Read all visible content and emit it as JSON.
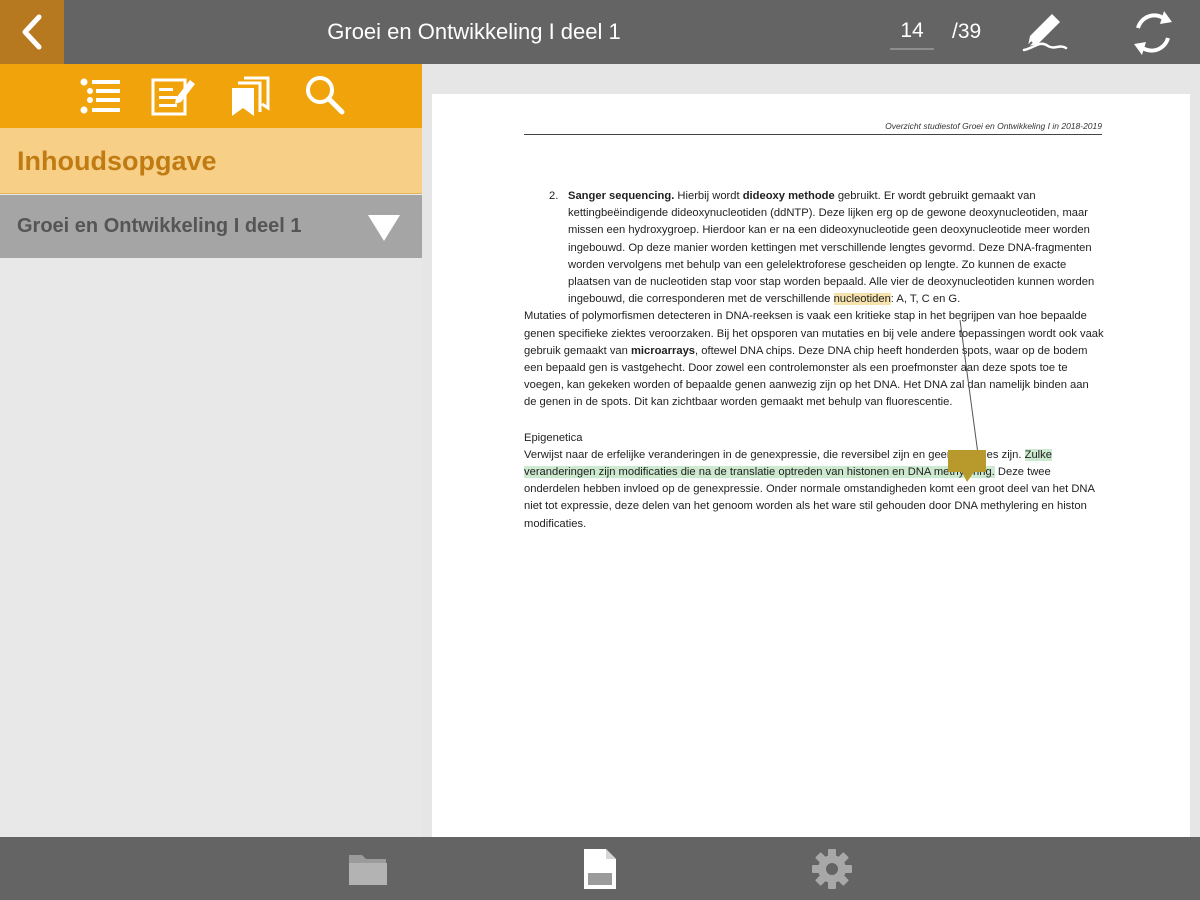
{
  "header": {
    "title": "Groei en Ontwikkeling I deel 1",
    "current_page": "14",
    "total_pages": "/39"
  },
  "sidebar": {
    "toolbar_icons": [
      "toc-list-icon",
      "notes-icon",
      "bookmarks-icon",
      "search-icon"
    ],
    "toc_title": "Inhoudsopgave",
    "items": [
      {
        "label": "Groei en Ontwikkeling I deel 1"
      }
    ]
  },
  "document": {
    "header_text": "Overzicht studiestof Groei en Ontwikkeling I in 2018-2019",
    "list_item": {
      "number": "2.",
      "bold_term": "Sanger sequencing.",
      "text_a": " Hierbij wordt ",
      "bold_method": "dideoxy methode",
      "text_b": " gebruikt. Er wordt gebruikt gemaakt van kettingbeëindigende dideoxynucleotiden (ddNTP). Deze lijken erg op de gewone deoxynucleotiden, maar missen een hydroxygroep. Hierdoor kan er na een dideoxynucleotide geen deoxynucleotide meer worden ingebouwd. Op deze manier worden kettingen met verschillende lengtes gevormd. Deze DNA-fragmenten worden vervolgens met behulp van een gelelektroforese gescheiden op lengte. Zo kunnen de exacte plaatsen van de nucleotiden stap voor stap worden bepaald. Alle vier de deoxynucleotiden kunnen worden ingebouwd, die corresponderen met de verschillende ",
      "highlight": "nucleotiden",
      "text_c": ": A, T, C en G."
    },
    "paragraph1_a": "Mutaties of polymorfismen detecteren in DNA-reeksen is vaak een kritieke stap in het begrijpen van hoe bepaalde genen specifieke ziektes veroorzaken. Bij het opsporen van mutaties en bij vele andere toepassingen wordt ook vaak gebruik gemaakt van ",
    "paragraph1_bold": "microarrays",
    "paragraph1_b": ", oftewel DNA chips. Deze DNA chip heeft honderden spots, waar op de bodem een bepaald gen is vastgehecht. Door zowel een controlemonster als een proefmonster aan deze spots toe te voegen, kan gekeken worden of bepaalde genen aanwezig zijn op het DNA. Het DNA zal dan namelijk binden aan de genen in de spots. Dit kan zichtbaar worden gemaakt met behulp van fluorescentie.",
    "section_title": "Epigenetica",
    "paragraph2_a": "Verwijst naar de erfelijke veranderingen in de genexpressie, die reversibel zijn en geen mutaties zijn. ",
    "paragraph2_highlight": "Zulke veranderingen zijn modificaties die na de translatie optreden van histonen en DNA methylering.",
    "paragraph2_b": " Deze twee onderdelen hebben invloed op de genexpressie. Onder normale omstandigheden komt een groot deel van het DNA niet tot expressie, deze delen van het genoom worden als het ware stil gehouden door DNA methylering en histon modificaties."
  },
  "colors": {
    "accent_orange": "#f0a30b",
    "back_button": "#b7791f",
    "toc_header_bg": "#f7cf87",
    "toc_header_text": "#c07c13",
    "bar_gray": "#646464",
    "highlight_yellow": "#f6e3ae",
    "highlight_green": "#cde9cf",
    "comment_marker": "#b89a2c"
  },
  "bottom_bar": {
    "icons": [
      "folder-icon",
      "document-icon",
      "settings-gear-icon"
    ]
  }
}
